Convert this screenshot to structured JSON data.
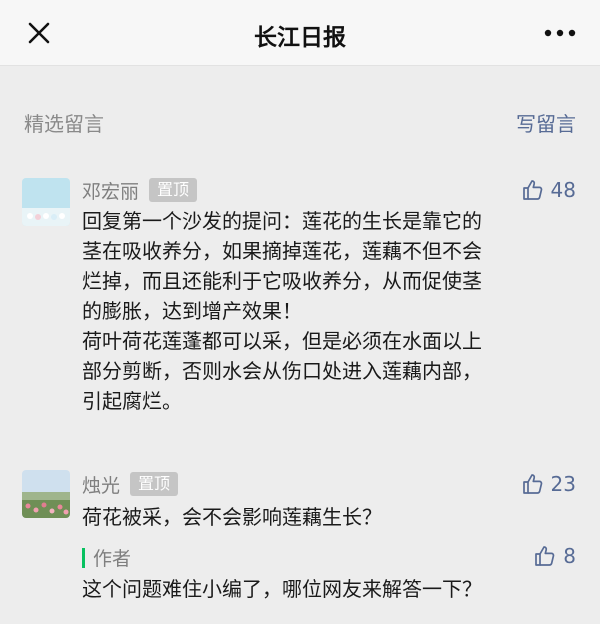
{
  "header": {
    "title": "长江日报",
    "close_icon": "close-icon",
    "more_icon": "more-horizontal-icon"
  },
  "section": {
    "title": "精选留言",
    "write_label": "写留言"
  },
  "comments": [
    {
      "nickname": "邓宏丽",
      "badge": "置顶",
      "likes": "48",
      "text": "回复第一个沙发的提问：莲花的生长是靠它的\n茎在吸收养分，如果摘掉莲花，莲藕不但不会\n烂掉，而且还能利于它吸收养分，从而促使茎\n的膨胀，达到增产效果！\n荷叶荷花莲蓬都可以采，但是必须在水面以上\n部分剪断，否则水会从伤口处进入莲藕内部，\n引起腐烂。"
    },
    {
      "nickname": "烛光",
      "badge": "置顶",
      "likes": "23",
      "text": "荷花被采，会不会影响莲藕生长？",
      "reply": {
        "author": "作者",
        "likes": "8",
        "text": "这个问题难住小编了，哪位网友来解答一下？"
      }
    }
  ],
  "colors": {
    "link": "#576b95",
    "badge_bg": "#c5c5c5",
    "reply_bar": "#07c160"
  }
}
